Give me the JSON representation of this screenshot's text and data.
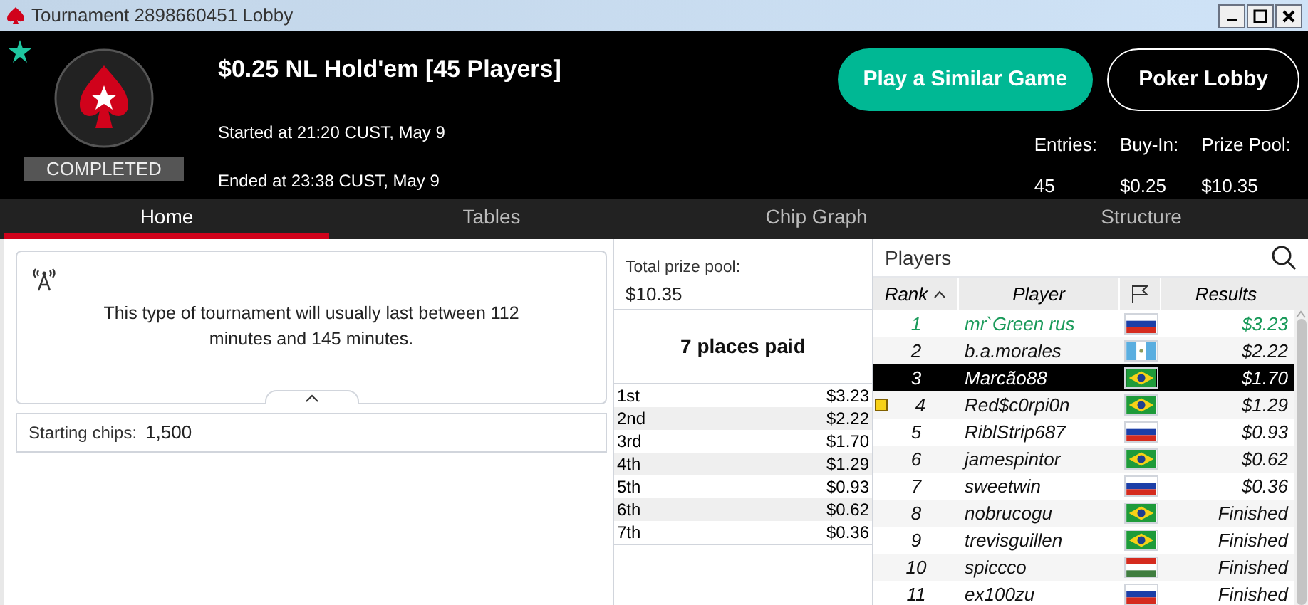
{
  "window": {
    "title": "Tournament 2898660451 Lobby"
  },
  "header": {
    "status": "COMPLETED",
    "title": "$0.25 NL Hold'em [45 Players]",
    "started": "Started at 21:20 CUST, May 9",
    "ended": "Ended at 23:38 CUST, May 9",
    "favorite": true,
    "buttons": [
      {
        "label": "Play a Similar Game",
        "kind": "primary"
      },
      {
        "label": "Poker Lobby",
        "kind": "outline"
      }
    ],
    "stats": [
      {
        "label": "Entries:",
        "value": "45"
      },
      {
        "label": "Buy-In:",
        "value": "$0.25"
      },
      {
        "label": "Prize Pool:",
        "value": "$10.35"
      }
    ]
  },
  "tabs": [
    {
      "label": "Home",
      "selected": true
    },
    {
      "label": "Tables",
      "selected": false
    },
    {
      "label": "Chip Graph",
      "selected": false
    },
    {
      "label": "Structure",
      "selected": false
    }
  ],
  "info": {
    "text": "This type of tournament will usually last between 112 minutes and 145 minutes.",
    "starting_chips_label": "Starting chips:",
    "starting_chips": "1,500"
  },
  "prizes": {
    "total_label": "Total prize pool:",
    "total": "$10.35",
    "places_paid": "7 places paid",
    "rows": [
      {
        "place": "1st",
        "amount": "$3.23"
      },
      {
        "place": "2nd",
        "amount": "$2.22"
      },
      {
        "place": "3rd",
        "amount": "$1.70"
      },
      {
        "place": "4th",
        "amount": "$1.29"
      },
      {
        "place": "5th",
        "amount": "$0.93"
      },
      {
        "place": "6th",
        "amount": "$0.62"
      },
      {
        "place": "7th",
        "amount": "$0.36"
      }
    ]
  },
  "players": {
    "title": "Players",
    "columns": [
      "Rank",
      "Player",
      "Results"
    ],
    "rows": [
      {
        "rank": "1",
        "name": "mr`Green rus",
        "kind": "russia",
        "result": "$3.23",
        "selected": false,
        "highlighted": true,
        "marked": false
      },
      {
        "rank": "2",
        "name": "b.a.morales",
        "kind": "guatemala",
        "result": "$2.22",
        "selected": false,
        "highlighted": false,
        "marked": false
      },
      {
        "rank": "3",
        "name": "Marcão88",
        "kind": "brazil",
        "result": "$1.70",
        "selected": true,
        "highlighted": false,
        "marked": false
      },
      {
        "rank": "4",
        "name": "Red$c0rpi0n",
        "kind": "brazil",
        "result": "$1.29",
        "selected": false,
        "highlighted": false,
        "marked": true
      },
      {
        "rank": "5",
        "name": "RiblStrip687",
        "kind": "russia",
        "result": "$0.93",
        "selected": false,
        "highlighted": false,
        "marked": false
      },
      {
        "rank": "6",
        "name": "jamespintor",
        "kind": "brazil",
        "result": "$0.62",
        "selected": false,
        "highlighted": false,
        "marked": false
      },
      {
        "rank": "7",
        "name": "sweetwin",
        "kind": "russia",
        "result": "$0.36",
        "selected": false,
        "highlighted": false,
        "marked": false
      },
      {
        "rank": "8",
        "name": "nobrucogu",
        "kind": "brazil",
        "result": "Finished",
        "selected": false,
        "highlighted": false,
        "marked": false
      },
      {
        "rank": "9",
        "name": "trevisguillen",
        "kind": "brazil",
        "result": "Finished",
        "selected": false,
        "highlighted": false,
        "marked": false
      },
      {
        "rank": "10",
        "name": "spiccco",
        "kind": "hungary",
        "result": "Finished",
        "selected": false,
        "highlighted": false,
        "marked": false
      },
      {
        "rank": "11",
        "name": "ex100zu",
        "kind": "russia",
        "result": "Finished",
        "selected": false,
        "highlighted": false,
        "marked": false
      }
    ]
  }
}
